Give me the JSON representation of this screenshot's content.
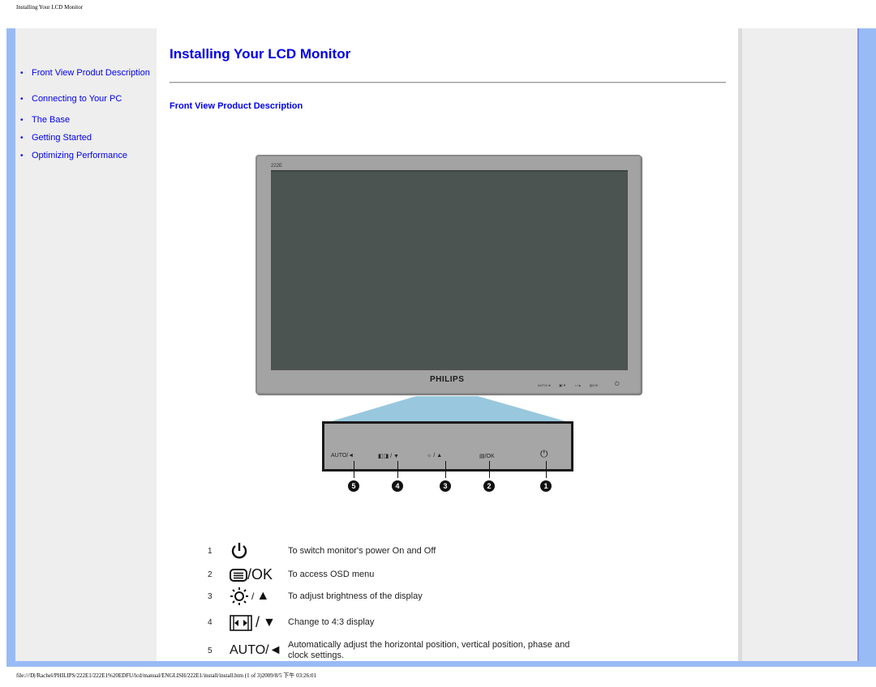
{
  "print_header": "Installing Your LCD Monitor",
  "print_footer": "file:///D|/Rachel/PHILIPS/222E1/222E1%20EDFU/lcd/manual/ENGLISH/222E1/install/install.htm (1 of 3)2009/8/5 下午 03:26:01",
  "nav": {
    "items": [
      {
        "label": "Front View Produt Description"
      },
      {
        "label": "Connecting to Your PC"
      },
      {
        "label": "The Base"
      },
      {
        "label": "Getting Started"
      },
      {
        "label": "Optimizing Performance"
      }
    ]
  },
  "main": {
    "title": "Installing Your LCD Monitor",
    "section_title": "Front View Product Description"
  },
  "monitor": {
    "model": "222E",
    "brand": "PHILIPS",
    "mini_buttons": [
      "AUTO/◄",
      "▣/▼",
      "☼/▲",
      "▤/OK"
    ],
    "panel_buttons": [
      {
        "label": "AUTO/◄",
        "callout": "5"
      },
      {
        "label": "◧◨ / ▼",
        "callout": "4"
      },
      {
        "label": "☼ / ▲",
        "callout": "3"
      },
      {
        "label": "▤/OK",
        "callout": "2"
      },
      {
        "label": "⏻",
        "callout": "1"
      }
    ]
  },
  "legend": [
    {
      "num": "1",
      "icon": "power-icon",
      "icon_text": "",
      "desc": "To switch monitor's power On and Off"
    },
    {
      "num": "2",
      "icon": "menu-ok-icon",
      "icon_text": "/OK",
      "desc": "To access OSD menu"
    },
    {
      "num": "3",
      "icon": "brightness-up-icon",
      "icon_text": "/",
      "desc": "To adjust brightness of the display"
    },
    {
      "num": "4",
      "icon": "aspect-down-icon",
      "icon_text": "/",
      "desc": "Change to 4:3 display"
    },
    {
      "num": "5",
      "icon": "auto-left-icon",
      "icon_text": "AUTO/◄",
      "desc": "Automatically adjust the horizontal position, vertical position, phase and clock settings."
    }
  ],
  "colors": {
    "link": "#0000ee",
    "frame": "#99bbf5",
    "panel": "#eeeeee"
  }
}
